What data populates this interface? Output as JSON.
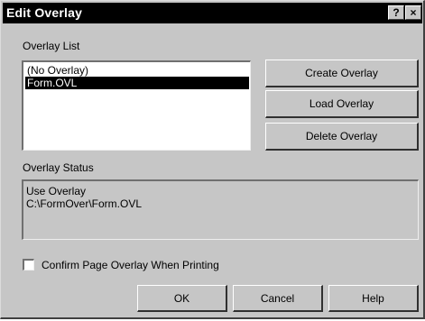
{
  "window": {
    "title": "Edit Overlay",
    "help_label": "?",
    "close_label": "×"
  },
  "overlay_list": {
    "label": "Overlay List",
    "items": [
      "(No Overlay)",
      "Form.OVL"
    ],
    "selected_index": 1
  },
  "actions": {
    "create": "Create Overlay",
    "load": "Load Overlay",
    "delete": "Delete Overlay"
  },
  "status": {
    "label": "Overlay Status",
    "lines": [
      "Use Overlay",
      "C:\\FormOver\\Form.OVL"
    ]
  },
  "confirm": {
    "label": "Confirm Page Overlay When Printing",
    "checked": false
  },
  "footer": {
    "ok": "OK",
    "cancel": "Cancel",
    "help": "Help"
  }
}
